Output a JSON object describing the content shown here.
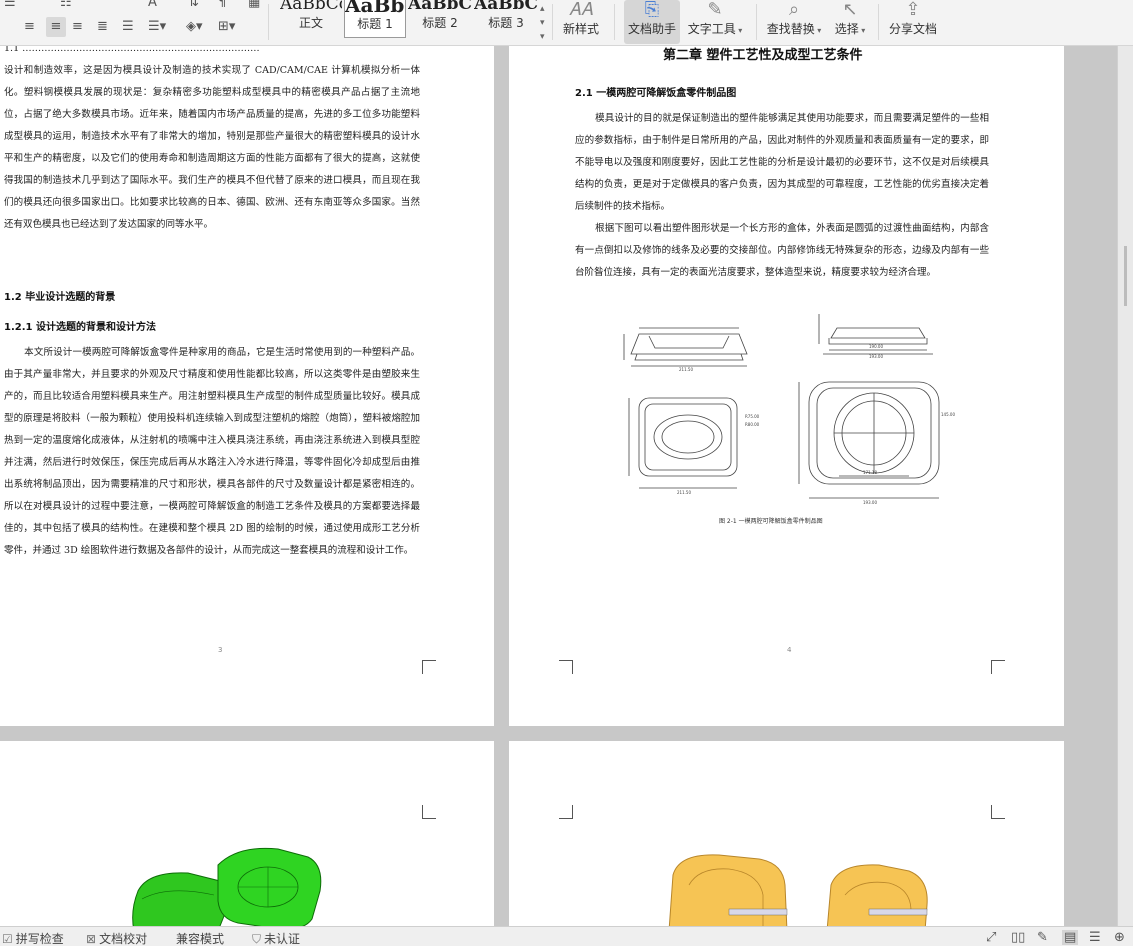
{
  "ribbon": {
    "styles": [
      {
        "sample": "AaBbCcI",
        "label": "正文"
      },
      {
        "sample": "AaBb(",
        "label": "标题 1"
      },
      {
        "sample": "AaBbCc",
        "label": "标题 2"
      },
      {
        "sample": "AaBbCcI",
        "label": "标题 3"
      }
    ],
    "new_style": "新样式",
    "doc_assistant": "文档助手",
    "text_tools": "文字工具",
    "find_replace": "查找替换",
    "select": "选择",
    "share": "分享文档"
  },
  "page3": {
    "para_intro": "设计和制造效率，这是因为模具设计及制造的技术实现了 CAD/CAM/CAE 计算机模拟分析一体化。塑料钢模模具发展的现状是：复杂精密多功能塑料成型模具中的精密模具产品占据了主流地位，占据了绝大多数模具市场。近年来，随着国内市场产品质量的提高，先进的多工位多功能塑料成型模具的运用，制造技术水平有了非常大的增加，特别是那些产量很大的精密塑料模具的设计水平和生产的精密度，以及它们的使用寿命和制造周期这方面的性能方面都有了很大的提高，这就使得我国的制造技术几乎到达了国际水平。我们生产的模具不但代替了原来的进口模具，而且现在我们的模具还向很多国家出口。比如要求比较高的日本、德国、欧洲、还有东南亚等众多国家。当然还有双色模具也已经达到了发达国家的同等水平。",
    "heading_1_2": "1.2  毕业设计选题的背景",
    "heading_1_2_1": "1.2.1  设计选题的背景和设计方法",
    "para_body": "本文所设计一模两腔可降解饭盒零件是种家用的商品，它是生活时常使用到的一种塑料产品。由于其产量非常大，并且要求的外观及尺寸精度和使用性能都比较高，所以这类零件是由塑胶来生产的，而且比较适合用塑料模具来生产。用注射塑料模具生产成型的制件成型质量比较好。模具成型的原理是将胶料（一般为颗粒）使用投料机连续输入到成型注塑机的熔腔（炮筒），塑料被熔腔加热到一定的温度熔化成液体，从注射机的喷嘴中注入模具浇注系统，再由浇注系统进入到模具型腔并注满，然后进行时效保压，保压完成后再从水路注入冷水进行降温，等零件固化冷却成型后由推出系统将制品顶出，因为需要精准的尺寸和形状，模具各部件的尺寸及数量设计都是紧密相连的。所以在对模具设计的过程中要注意，一模两腔可降解饭盒的制造工艺条件及模具的方案都要选择最佳的，其中包括了模具的结构性。在建模和整个模具 2D 图的绘制的时候，通过使用成形工艺分析零件，并通过 3D 绘图软件进行数据及各部件的设计，从而完成这一整套模具的流程和设计工作。",
    "page_number": "3"
  },
  "page4": {
    "chapter_title": "第二章  塑件工艺性及成型工艺条件",
    "heading_2_1": "2.1  一模两腔可降解饭盒零件制品图",
    "para_1": "模具设计的目的就是保证制造出的塑件能够满足其使用功能要求，而且需要满足塑件的一些相应的参数指标，由于制件是日常所用的产品，因此对制件的外观质量和表面质量有一定的要求，即不能导电以及强度和刚度要好，因此工艺性能的分析是设计最初的必要环节，这不仅是对后续模具结构的负责，更是对于定做模具的客户负责，因为其成型的可靠程度，工艺性能的优劣直接决定着后续制件的技术指标。",
    "para_2": "根据下图可以看出塑件图形状是一个长方形的盒体，外表面是圆弧的过渡性曲面结构，内部含有一点倒扣以及修饰的线条及必要的交接部位。内部修饰线无特殊复杂的形态，边缘及内部有一些台阶昝位连接，具有一定的表面光洁度要求，整体造型来说，精度要求较为经济合理。",
    "figure_caption": "图 2-1  一模两腔可降解饭盒零件制品图",
    "dims": {
      "top_len": "211.50",
      "side_len": "190.00",
      "side_len2": "193.00",
      "bottom_len": "211.50",
      "bottom_len2": "193.00",
      "inner": "171.18",
      "r1": "R75.00",
      "r2": "R80.00",
      "h1": "17.00",
      "w1": "145.00"
    },
    "page_number": "4"
  },
  "statusbar": {
    "spell_check": "拼写检查",
    "doc_proof": "文档校对",
    "compat_mode": "兼容模式",
    "uncertified": "未认证"
  }
}
